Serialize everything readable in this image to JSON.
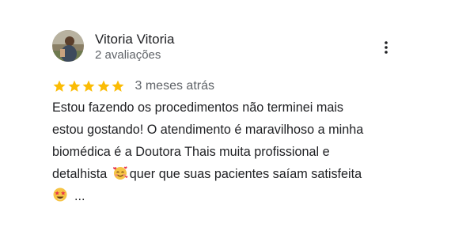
{
  "review": {
    "author_name": "Vitoria Vitoria",
    "review_count": "2 avaliações",
    "rating": 5,
    "rating_max": 5,
    "time_ago": "3 meses atrás",
    "text": {
      "line1": "Estou fazendo os procedimentos não terminei mais",
      "line2": "estou gostando! O atendimento é maravilhoso a minha",
      "line3": "biomédica é a Doutora Thais muita profissional e",
      "line4_before_emoji": "detalhista",
      "line4_after_emoji": "quer que suas pacientes saíam satisfeita",
      "ellipsis": "..."
    }
  },
  "colors": {
    "star": "#fbbc04",
    "name": "#202124",
    "secondary": "#5f6368"
  },
  "icons": {
    "more": "more-vert-icon",
    "star": "star-icon",
    "emoji_1": "smiling-face-with-hearts-emoji",
    "emoji_2": "star-struck-emoji"
  }
}
